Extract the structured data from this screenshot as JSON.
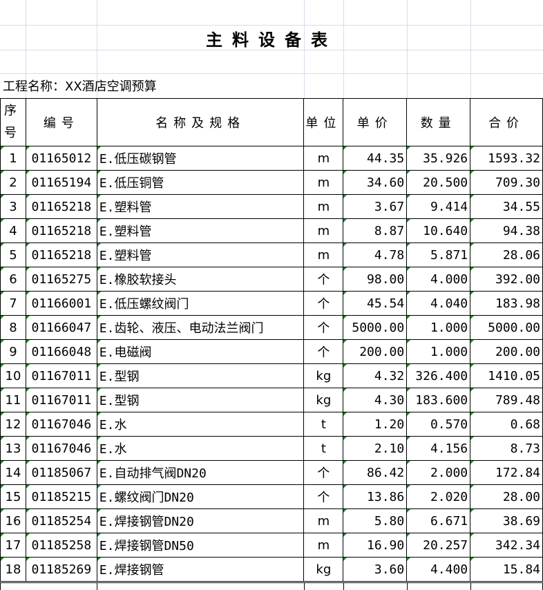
{
  "title": "主料设备表",
  "project_label": "工程名称：XX酒店空调预算",
  "headers": {
    "seq": [
      "序",
      "号"
    ],
    "code": "编号",
    "name": "名称及规格",
    "unit": "单位",
    "price": "单价",
    "qty": "数量",
    "total": "合价"
  },
  "rows": [
    {
      "seq": "1",
      "code": "01165012",
      "name": "E.低压碳钢管",
      "unit": "m",
      "price": "44.35",
      "qty": "35.926",
      "total": "1593.32"
    },
    {
      "seq": "2",
      "code": "01165194",
      "name": "E.低压铜管",
      "unit": "m",
      "price": "34.60",
      "qty": "20.500",
      "total": "709.30"
    },
    {
      "seq": "3",
      "code": "01165218",
      "name": "E.塑料管",
      "unit": "m",
      "price": "3.67",
      "qty": "9.414",
      "total": "34.55"
    },
    {
      "seq": "4",
      "code": "01165218",
      "name": "E.塑料管",
      "unit": "m",
      "price": "8.87",
      "qty": "10.640",
      "total": "94.38"
    },
    {
      "seq": "5",
      "code": "01165218",
      "name": "E.塑料管",
      "unit": "m",
      "price": "4.78",
      "qty": "5.871",
      "total": "28.06"
    },
    {
      "seq": "6",
      "code": "01165275",
      "name": "E.橡胶软接头",
      "unit": "个",
      "price": "98.00",
      "qty": "4.000",
      "total": "392.00"
    },
    {
      "seq": "7",
      "code": "01166001",
      "name": "E.低压螺纹阀门",
      "unit": "个",
      "price": "45.54",
      "qty": "4.040",
      "total": "183.98"
    },
    {
      "seq": "8",
      "code": "01166047",
      "name": "E.齿轮、液压、电动法兰阀门",
      "unit": "个",
      "price": "5000.00",
      "qty": "1.000",
      "total": "5000.00"
    },
    {
      "seq": "9",
      "code": "01166048",
      "name": "E.电磁阀",
      "unit": "个",
      "price": "200.00",
      "qty": "1.000",
      "total": "200.00"
    },
    {
      "seq": "10",
      "code": "01167011",
      "name": "E.型钢",
      "unit": "kg",
      "price": "4.32",
      "qty": "326.400",
      "total": "1410.05"
    },
    {
      "seq": "11",
      "code": "01167011",
      "name": "E.型钢",
      "unit": "kg",
      "price": "4.30",
      "qty": "183.600",
      "total": "789.48"
    },
    {
      "seq": "12",
      "code": "01167046",
      "name": "E.水",
      "unit": "t",
      "price": "1.20",
      "qty": "0.570",
      "total": "0.68"
    },
    {
      "seq": "13",
      "code": "01167046",
      "name": "E.水",
      "unit": "t",
      "price": "2.10",
      "qty": "4.156",
      "total": "8.73"
    },
    {
      "seq": "14",
      "code": "01185067",
      "name": "E.自动排气阀DN20",
      "unit": "个",
      "price": "86.42",
      "qty": "2.000",
      "total": "172.84"
    },
    {
      "seq": "15",
      "code": "01185215",
      "name": "E.螺纹阀门DN20",
      "unit": "个",
      "price": "13.86",
      "qty": "2.020",
      "total": "28.00"
    },
    {
      "seq": "16",
      "code": "01185254",
      "name": "E.焊接钢管DN20",
      "unit": "m",
      "price": "5.80",
      "qty": "6.671",
      "total": "38.69"
    },
    {
      "seq": "17",
      "code": "01185258",
      "name": "E.焊接钢管DN50",
      "unit": "m",
      "price": "16.90",
      "qty": "20.257",
      "total": "342.34"
    },
    {
      "seq": "18",
      "code": "01185269",
      "name": "E.焊接钢管",
      "unit": "kg",
      "price": "3.60",
      "qty": "4.400",
      "total": "15.84"
    }
  ]
}
